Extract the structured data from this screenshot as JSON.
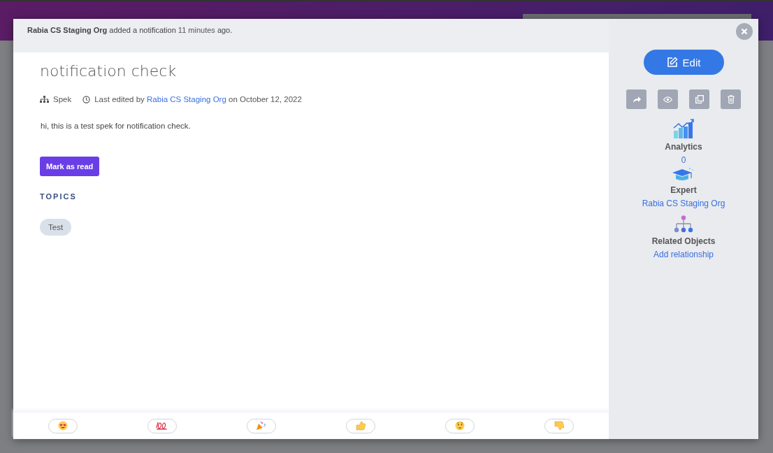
{
  "notice": {
    "actor": "Rabia CS Staging Org",
    "text": "added a notification",
    "time": "11 minutes",
    "suffix": "ago."
  },
  "spek": {
    "title": "notification check",
    "type": "Spek",
    "edited_prefix": "Last edited by",
    "editor": "Rabia CS Staging Org",
    "edited_suffix": "on October 12, 2022",
    "body": "hi, this is a test spek for notification check.",
    "mark_read": "Mark as read",
    "topics_heading": "TOPICS",
    "topics": [
      "Test"
    ]
  },
  "sidebar": {
    "edit": "Edit",
    "actions": [
      {
        "kind": "share"
      },
      {
        "kind": "view"
      },
      {
        "kind": "copy"
      },
      {
        "kind": "delete"
      }
    ],
    "sections": [
      {
        "kind": "analytics",
        "title": "Analytics",
        "value": "0"
      },
      {
        "kind": "expert",
        "title": "Expert",
        "value": "Rabia CS Staging Org"
      },
      {
        "kind": "related",
        "title": "Related Objects",
        "value": "Add relationship"
      }
    ]
  },
  "reactions": [
    {
      "kind": "heart-eyes"
    },
    {
      "kind": "hundred"
    },
    {
      "kind": "party"
    },
    {
      "kind": "thumbs-up"
    },
    {
      "kind": "thinking"
    },
    {
      "kind": "thumbs-down"
    }
  ]
}
